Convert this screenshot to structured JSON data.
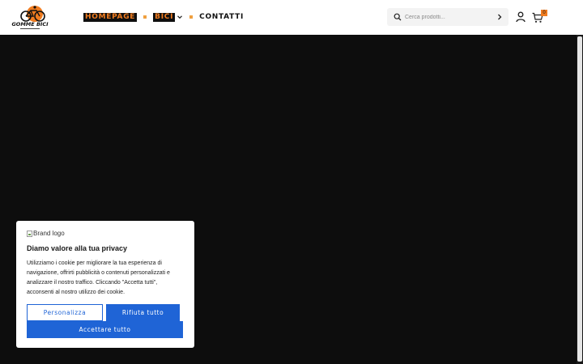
{
  "header": {
    "logo_alt": "Gomme Bici",
    "logo_text": "GOMME BICI",
    "nav": [
      {
        "label": "HOMEPAGE"
      },
      {
        "label": "BICI"
      },
      {
        "label": "CONTATTI"
      }
    ],
    "search": {
      "placeholder": "Cerca prodotti..."
    },
    "cart_count": "0"
  },
  "colors": {
    "accent": "#f07c20",
    "button_blue": "#1f64d6",
    "page_background": "#0d0d0d"
  },
  "cookie": {
    "brand_alt": "Brand logo",
    "title": "Diamo valore alla tua privacy",
    "body": "Utilizziamo i cookie per migliorare la tua esperienza di navigazione, offrirti pubblicità o contenuti personalizzati e analizzare il nostro traffico. Cliccando \"Accetta tutti\", acconsenti al nostro utilizzo dei cookie.",
    "customize_label": "Personalizza",
    "reject_label": "Rifiuta tutto",
    "accept_label": "Accettare tutto"
  }
}
